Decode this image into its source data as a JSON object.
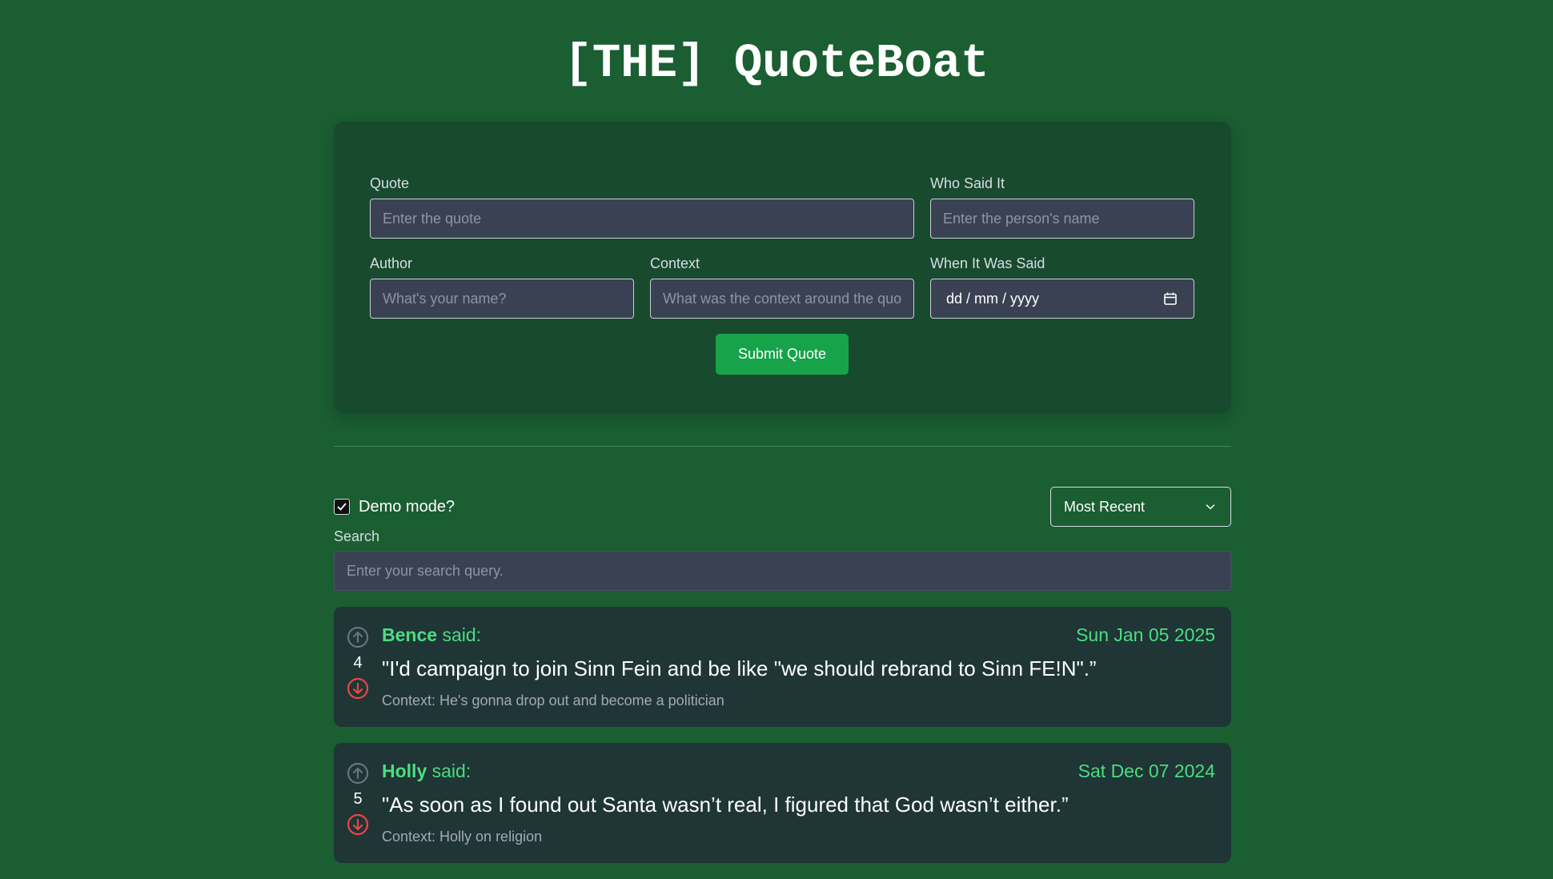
{
  "app": {
    "title": "[THE] QuoteBoat"
  },
  "form": {
    "quote": {
      "label": "Quote",
      "placeholder": "Enter the quote",
      "value": ""
    },
    "who_said": {
      "label": "Who Said It",
      "placeholder": "Enter the person's name",
      "value": ""
    },
    "author": {
      "label": "Author",
      "placeholder": "What's your name?",
      "value": ""
    },
    "context": {
      "label": "Context",
      "placeholder": "What was the context around the quote?",
      "value": ""
    },
    "date": {
      "label": "When It Was Said",
      "display": "dd / mm / yyyy",
      "icon": "calendar-icon"
    },
    "submit_label": "Submit Quote"
  },
  "controls": {
    "demo_mode": {
      "label": "Demo mode?",
      "checked": true
    },
    "sort": {
      "selected": "Most Recent",
      "icon": "chevron-down-icon"
    },
    "search": {
      "label": "Search",
      "placeholder": "Enter your search query.",
      "value": ""
    }
  },
  "quotes": [
    {
      "name": "Bence",
      "said": "said:",
      "date": "Sun Jan 05 2025",
      "text": "\"I'd campaign to join Sinn Fein and be like \"we should rebrand to Sinn FE!N\".”",
      "context": "Context: He's gonna drop out and become a politician",
      "votes": "4"
    },
    {
      "name": "Holly",
      "said": "said:",
      "date": "Sat Dec 07 2024",
      "text": "\"As soon as I found out Santa wasn’t real, I figured that God wasn’t either.”",
      "context": "Context: Holly on religion",
      "votes": "5"
    }
  ],
  "colors": {
    "background": "#1a5e31",
    "card": "#184a2e",
    "quote_card": "#1f3536",
    "accent_green": "#4ade80",
    "submit_button": "#16a34a",
    "downvote": "#ef4444",
    "upvote": "#6b7280"
  }
}
